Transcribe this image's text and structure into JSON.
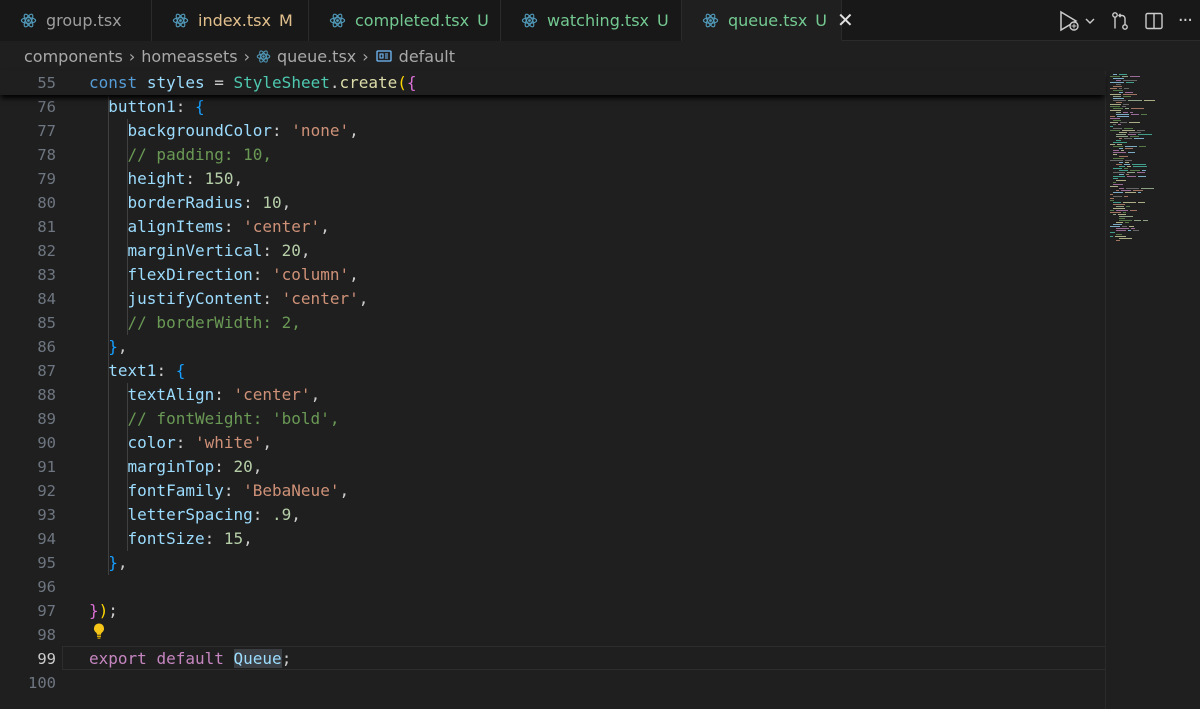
{
  "tabs": [
    {
      "name": "group.tsx",
      "status": "",
      "kind": "plain"
    },
    {
      "name": "index.tsx",
      "status": "M",
      "kind": "modified"
    },
    {
      "name": "completed.tsx",
      "status": "U",
      "kind": "new"
    },
    {
      "name": "watching.tsx",
      "status": "U",
      "kind": "new"
    },
    {
      "name": "queue.tsx",
      "status": "U",
      "kind": "new",
      "active": true,
      "close": "✕"
    }
  ],
  "actions": {
    "run_icon": "run-debug-icon",
    "chevron_icon": "chevron-down-icon",
    "compare_icon": "compare-changes-icon",
    "split_icon": "split-editor-icon",
    "more": "···"
  },
  "breadcrumb": {
    "items": [
      "components",
      "homeassets",
      "queue.tsx",
      "default"
    ],
    "separator": "›"
  },
  "editor": {
    "sticky": {
      "number": "55",
      "text": "const styles = StyleSheet.create({"
    },
    "current_line": "99",
    "lines": [
      {
        "n": "76",
        "text": "  button1: {"
      },
      {
        "n": "77",
        "text": "    backgroundColor: 'none',"
      },
      {
        "n": "78",
        "text": "    // padding: 10,"
      },
      {
        "n": "79",
        "text": "    height: 150,"
      },
      {
        "n": "80",
        "text": "    borderRadius: 10,"
      },
      {
        "n": "81",
        "text": "    alignItems: 'center',"
      },
      {
        "n": "82",
        "text": "    marginVertical: 20,"
      },
      {
        "n": "83",
        "text": "    flexDirection: 'column',"
      },
      {
        "n": "84",
        "text": "    justifyContent: 'center',"
      },
      {
        "n": "85",
        "text": "    // borderWidth: 2,"
      },
      {
        "n": "86",
        "text": "  },"
      },
      {
        "n": "87",
        "text": "  text1: {"
      },
      {
        "n": "88",
        "text": "    textAlign: 'center',"
      },
      {
        "n": "89",
        "text": "    // fontWeight: 'bold',"
      },
      {
        "n": "90",
        "text": "    color: 'white',"
      },
      {
        "n": "91",
        "text": "    marginTop: 20,"
      },
      {
        "n": "92",
        "text": "    fontFamily: 'BebaNeue',"
      },
      {
        "n": "93",
        "text": "    letterSpacing: .9,"
      },
      {
        "n": "94",
        "text": "    fontSize: 15,"
      },
      {
        "n": "95",
        "text": "  },"
      },
      {
        "n": "96",
        "text": ""
      },
      {
        "n": "97",
        "text": "});"
      },
      {
        "n": "98",
        "text": ""
      },
      {
        "n": "99",
        "text": "export default Queue;"
      },
      {
        "n": "100",
        "text": ""
      }
    ]
  },
  "colors": {
    "editor_bg": "#1f1f1f",
    "tabbar_bg": "#181818",
    "keyword": "#c586c0",
    "property": "#9cdcfe",
    "string": "#ce9178",
    "number": "#b5cea8",
    "comment": "#6a9955",
    "function": "#dcdcaa",
    "class": "#4ec9b0",
    "modified": "#e2c08d",
    "untracked": "#73c991",
    "react_icon": "#519aba"
  }
}
